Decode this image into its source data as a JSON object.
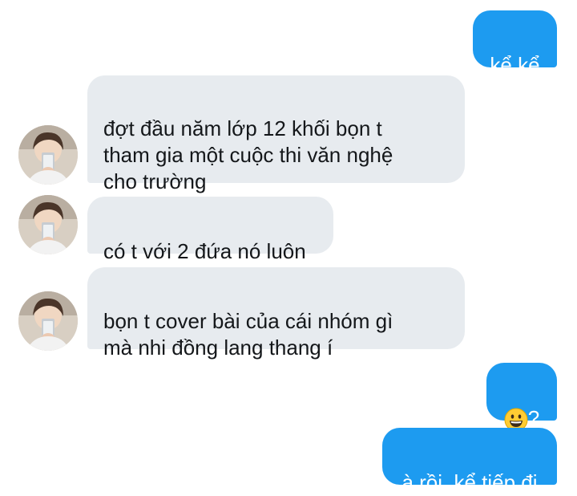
{
  "conversation": {
    "messages": [
      {
        "side": "sent",
        "text": "kể kể"
      },
      {
        "side": "received",
        "text": "đợt đầu năm lớp 12 khối bọn t\ntham gia một cuộc thi văn nghệ\ncho trường"
      },
      {
        "side": "received",
        "text": "có t với 2 đứa nó luôn"
      },
      {
        "side": "received",
        "text": "bọn t cover bài của cái nhóm gì\nmà nhi đồng lang thang í"
      },
      {
        "side": "sent",
        "emoji": "grinning-face",
        "text": "?"
      },
      {
        "side": "sent",
        "text": "à rồi, kể tiếp đi"
      }
    ]
  },
  "colors": {
    "sent_bubble": "#1d9bf0",
    "received_bubble": "#e7ebef",
    "received_text": "#14171a"
  }
}
